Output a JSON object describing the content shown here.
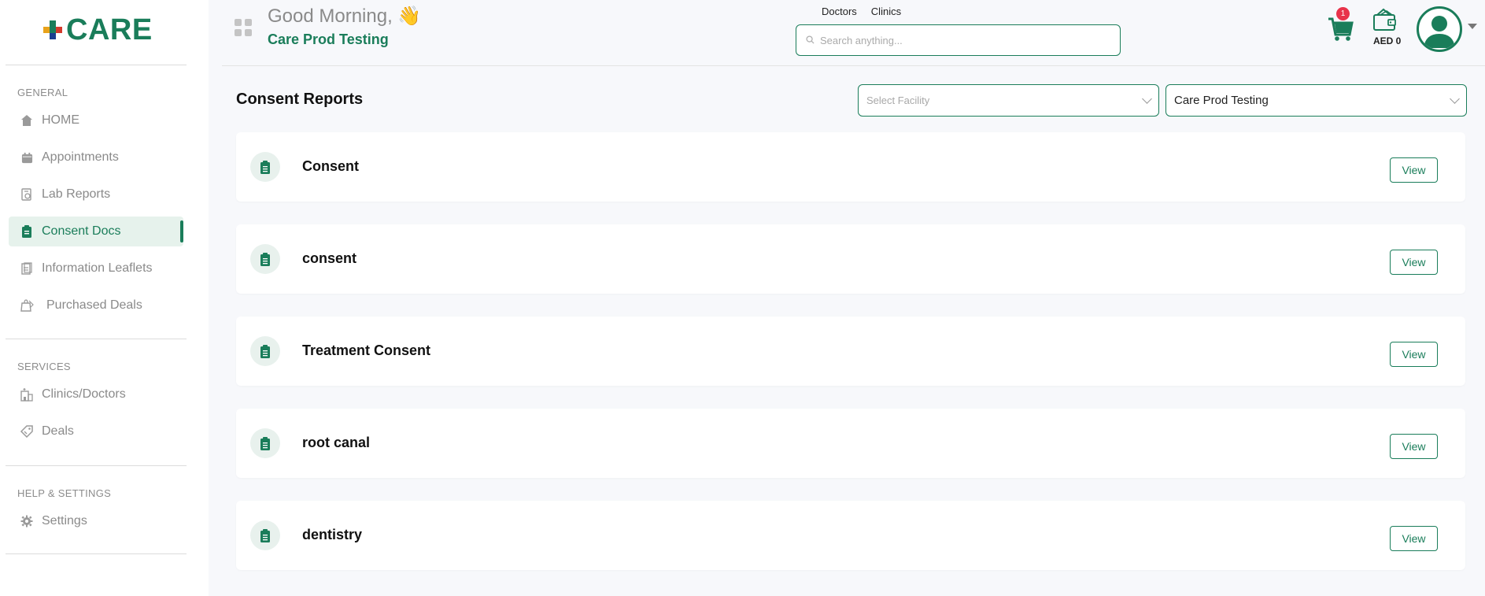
{
  "brand": {
    "name": "CARE"
  },
  "sidebar": {
    "sections": [
      {
        "label": "GENERAL"
      },
      {
        "label": "SERVICES"
      },
      {
        "label": "HELP & SETTINGS"
      }
    ],
    "items": [
      {
        "label": "HOME",
        "icon": "home-icon"
      },
      {
        "label": "Appointments",
        "icon": "calendar-icon"
      },
      {
        "label": "Lab Reports",
        "icon": "lab-report-icon"
      },
      {
        "label": "Consent Docs",
        "icon": "clipboard-icon",
        "active": true
      },
      {
        "label": "Information Leaflets",
        "icon": "leaflet-icon"
      },
      {
        "label": "Purchased Deals",
        "icon": "deal-bag-icon"
      },
      {
        "label": "Clinics/Doctors",
        "icon": "clinic-icon"
      },
      {
        "label": "Deals",
        "icon": "tag-icon"
      },
      {
        "label": "Settings",
        "icon": "gear-icon"
      }
    ]
  },
  "header": {
    "greeting": "Good Morning, 👋",
    "org_name": "Care Prod Testing",
    "search_tabs": [
      "Doctors",
      "Clinics"
    ],
    "search_placeholder": "Search anything...",
    "cart_count": "1",
    "wallet_amount": "AED 0"
  },
  "main": {
    "title": "Consent Reports",
    "facility_select": {
      "placeholder": "Select Facility"
    },
    "org_select": {
      "value": "Care Prod Testing"
    },
    "reports": [
      {
        "title": "Consent",
        "action": "View"
      },
      {
        "title": "consent",
        "action": "View"
      },
      {
        "title": "Treatment Consent",
        "action": "View"
      },
      {
        "title": "root canal",
        "action": "View"
      },
      {
        "title": "dentistry",
        "action": "View"
      }
    ]
  },
  "colors": {
    "accent": "#1a7d5a",
    "badge": "#e8334a",
    "active_bg": "#e6f2ec"
  }
}
